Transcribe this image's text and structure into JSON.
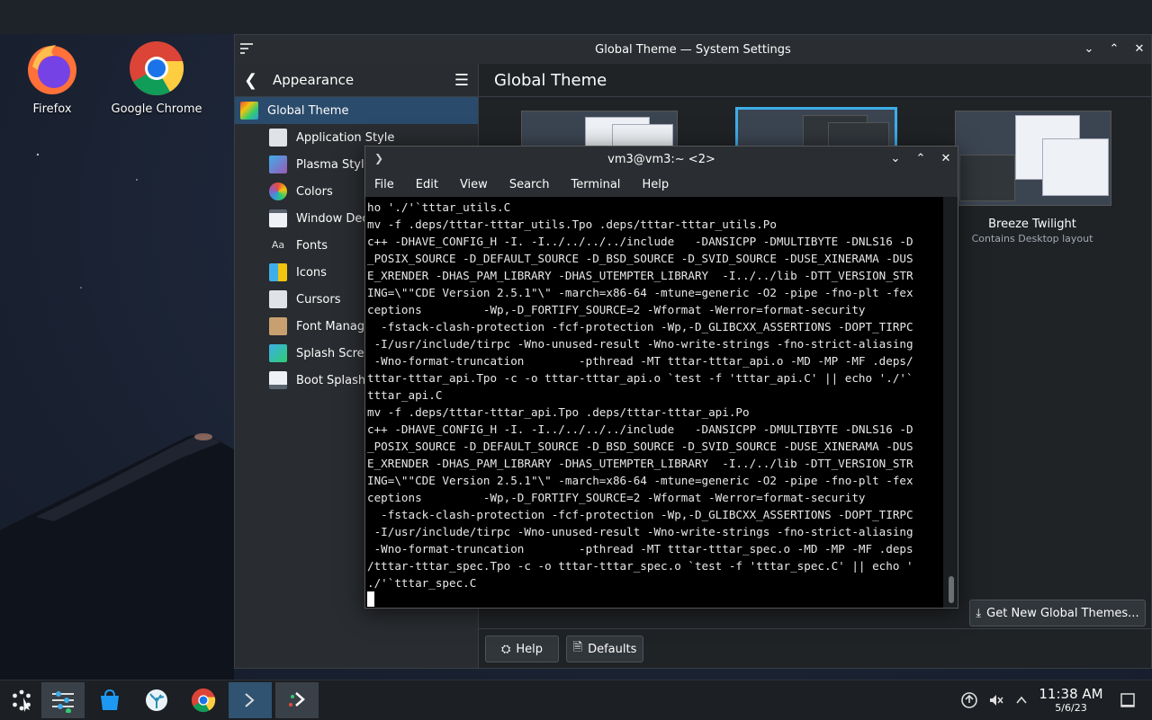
{
  "desktop": {
    "icons": [
      {
        "label": "Firefox"
      },
      {
        "label": "Google Chrome"
      }
    ]
  },
  "settings": {
    "title": "Global Theme — System Settings",
    "sidebar": {
      "header": "Appearance",
      "items": [
        {
          "label": "Global Theme",
          "active": true
        },
        {
          "label": "Application Style"
        },
        {
          "label": "Plasma Style"
        },
        {
          "label": "Colors"
        },
        {
          "label": "Window Deco"
        },
        {
          "label": "Fonts"
        },
        {
          "label": "Icons"
        },
        {
          "label": "Cursors"
        },
        {
          "label": "Font Manage"
        },
        {
          "label": "Splash Scree"
        },
        {
          "label": "Boot Splash"
        }
      ]
    },
    "main": {
      "title": "Global Theme",
      "themes": [
        {
          "name": "Breeze Twilight",
          "subtitle": "Contains Desktop layout"
        }
      ],
      "get_new": "Get New Global Themes...",
      "help": "Help",
      "defaults": "Defaults"
    }
  },
  "terminal": {
    "title": "vm3@vm3:~ <2>",
    "menu": [
      "File",
      "Edit",
      "View",
      "Search",
      "Terminal",
      "Help"
    ],
    "lines": [
      "ho './'`tttar_utils.C",
      "mv -f .deps/tttar-tttar_utils.Tpo .deps/tttar-tttar_utils.Po",
      "c++ -DHAVE_CONFIG_H -I. -I../../../../include   -DANSICPP -DMULTIBYTE -DNLS16 -D",
      "_POSIX_SOURCE -D_DEFAULT_SOURCE -D_BSD_SOURCE -D_SVID_SOURCE -DUSE_XINERAMA -DUS",
      "E_XRENDER -DHAS_PAM_LIBRARY -DHAS_UTEMPTER_LIBRARY  -I../../lib -DTT_VERSION_STR",
      "ING=\\\"\"CDE Version 2.5.1\"\\\" -march=x86-64 -mtune=generic -O2 -pipe -fno-plt -fex",
      "ceptions         -Wp,-D_FORTIFY_SOURCE=2 -Wformat -Werror=format-security",
      "  -fstack-clash-protection -fcf-protection -Wp,-D_GLIBCXX_ASSERTIONS -DOPT_TIRPC",
      " -I/usr/include/tirpc -Wno-unused-result -Wno-write-strings -fno-strict-aliasing",
      " -Wno-format-truncation        -pthread -MT tttar-tttar_api.o -MD -MP -MF .deps/",
      "tttar-tttar_api.Tpo -c -o tttar-tttar_api.o `test -f 'tttar_api.C' || echo './'`",
      "tttar_api.C",
      "mv -f .deps/tttar-tttar_api.Tpo .deps/tttar-tttar_api.Po",
      "c++ -DHAVE_CONFIG_H -I. -I../../../../include   -DANSICPP -DMULTIBYTE -DNLS16 -D",
      "_POSIX_SOURCE -D_DEFAULT_SOURCE -D_BSD_SOURCE -D_SVID_SOURCE -DUSE_XINERAMA -DUS",
      "E_XRENDER -DHAS_PAM_LIBRARY -DHAS_UTEMPTER_LIBRARY  -I../../lib -DTT_VERSION_STR",
      "ING=\\\"\"CDE Version 2.5.1\"\\\" -march=x86-64 -mtune=generic -O2 -pipe -fno-plt -fex",
      "ceptions         -Wp,-D_FORTIFY_SOURCE=2 -Wformat -Werror=format-security",
      "  -fstack-clash-protection -fcf-protection -Wp,-D_GLIBCXX_ASSERTIONS -DOPT_TIRPC",
      " -I/usr/include/tirpc -Wno-unused-result -Wno-write-strings -fno-strict-aliasing",
      " -Wno-format-truncation        -pthread -MT tttar-tttar_spec.o -MD -MP -MF .deps",
      "/tttar-tttar_spec.Tpo -c -o tttar-tttar_spec.o `test -f 'tttar_spec.C' || echo '",
      "./'`tttar_spec.C"
    ]
  },
  "taskbar": {
    "clock_time": "11:38 AM",
    "clock_date": "5/6/23"
  },
  "colors": {
    "accent": "#3daee9",
    "selection": "#2a4b6b"
  }
}
